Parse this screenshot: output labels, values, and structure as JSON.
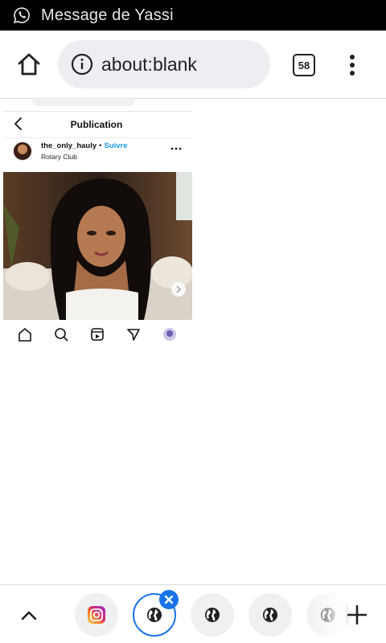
{
  "notification": {
    "app_icon": "whatsapp-icon",
    "text": "Message de Yassi"
  },
  "toolbar": {
    "home_icon": "home-icon",
    "info_icon": "info-icon",
    "url": "about:blank",
    "tab_count": "58",
    "menu_icon": "more-vert-icon"
  },
  "content": {
    "header_title": "Publication",
    "username": "the_only_hauly",
    "separator": "•",
    "follow_label": "Suivre",
    "location": "Rotary Club"
  },
  "tabstrip": {
    "tabs": [
      {
        "icon": "instagram-icon"
      },
      {
        "icon": "globe-icon",
        "active": true
      },
      {
        "icon": "globe-icon"
      },
      {
        "icon": "globe-icon"
      },
      {
        "icon": "globe-icon"
      }
    ]
  },
  "colors": {
    "accent": "#1a73e8",
    "follow": "#1d9bf0",
    "notification_bg": "#000000",
    "omnibox_bg": "#eceef1"
  }
}
